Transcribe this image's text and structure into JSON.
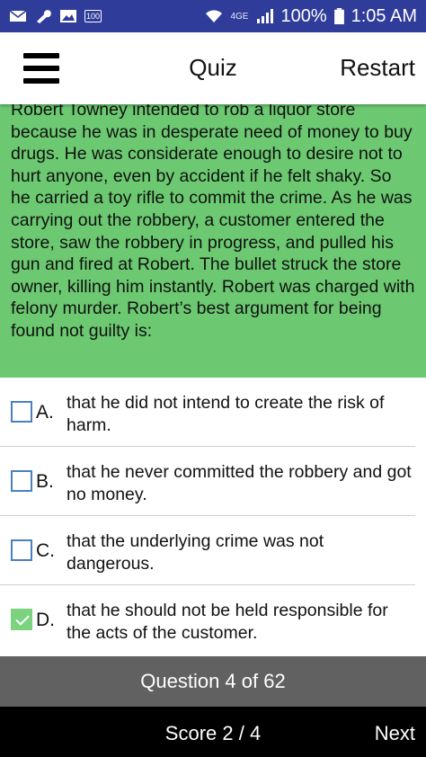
{
  "status_bar": {
    "notification_badge": "100",
    "network_label": "4GE",
    "battery_percent": "100%",
    "time": "1:05 AM"
  },
  "app_bar": {
    "title": "Quiz",
    "restart_label": "Restart"
  },
  "question": {
    "text": "Robert Towney intended to rob a liquor store because he was in desperate need of money to buy drugs. He was considerate enough to desire not to hurt anyone, even by accident if he felt shaky. So he carried a toy rifle to commit the crime. As he was carrying out the robbery, a customer entered the store, saw the robbery in progress, and pulled his gun and fired at Robert. The bullet struck the store owner, killing him instantly. Robert was charged with felony murder. Robert’s best argument for being found not guilty is:"
  },
  "answers": [
    {
      "letter": "A.",
      "text": "that he did not intend to create the risk of harm.",
      "checked": false
    },
    {
      "letter": "B.",
      "text": "that he never committed the robbery and got no money.",
      "checked": false
    },
    {
      "letter": "C.",
      "text": "that the underlying crime was not dangerous.",
      "checked": false
    },
    {
      "letter": "D.",
      "text": "that he should not be held responsible for the acts of the customer.",
      "checked": true
    }
  ],
  "progress": {
    "label": "Question 4 of 62"
  },
  "footer": {
    "score_label": "Score 2 / 4",
    "next_label": "Next"
  },
  "colors": {
    "status_bar": "#2f3c9a",
    "question_bg": "#6cc971",
    "checkbox_border": "#4a7fc0",
    "checkbox_checked": "#7bd37f",
    "progress_bar": "#616161",
    "footer_bg": "#000000"
  }
}
